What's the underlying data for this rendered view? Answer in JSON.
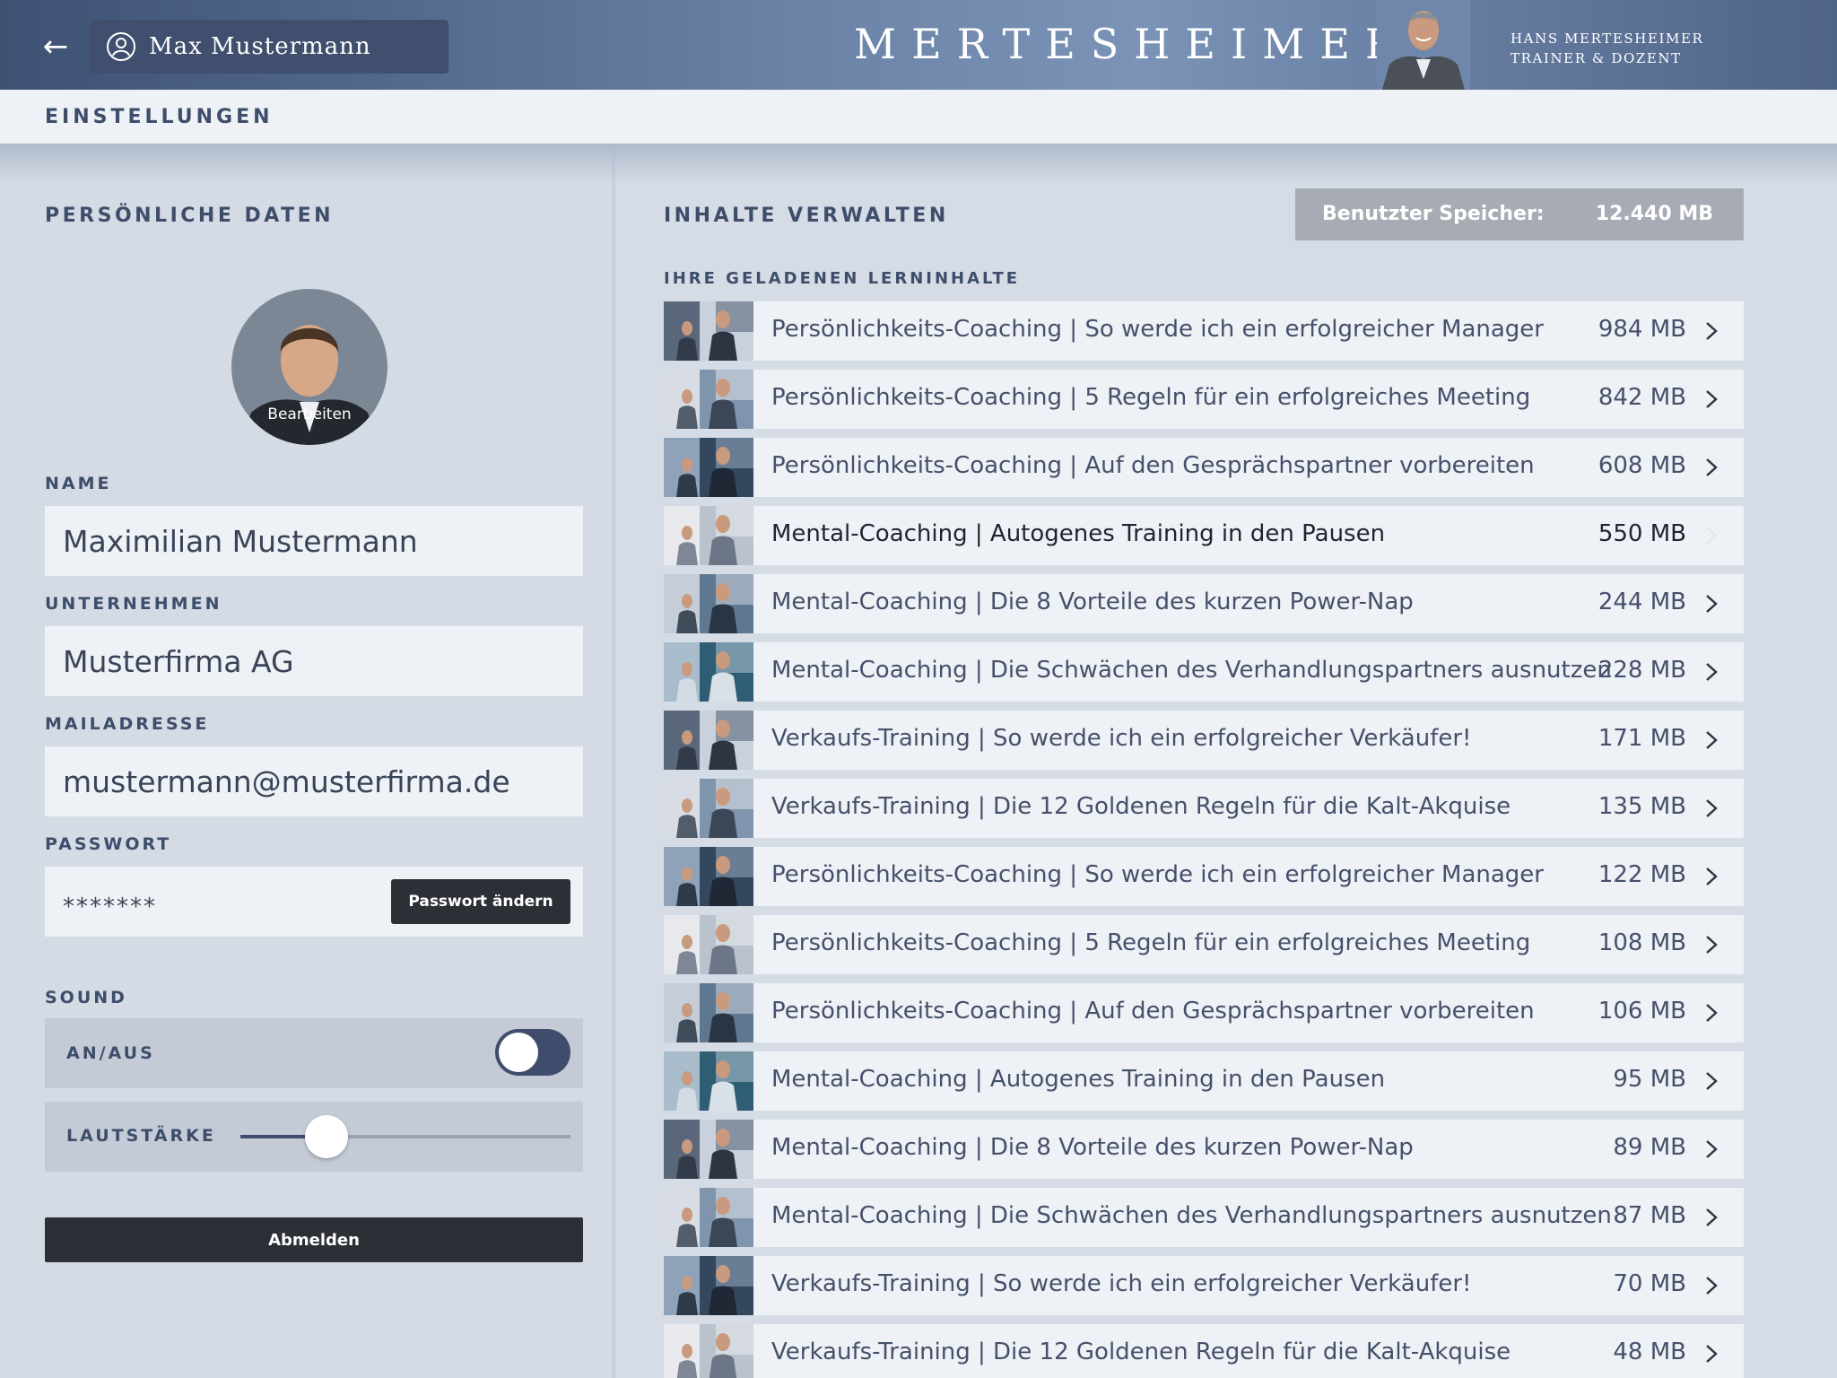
{
  "header": {
    "user_name": "Max Mustermann",
    "brand": "MERTESHEIMER",
    "trainer_name": "HANS MERTESHEIMER",
    "trainer_role": "TRAINER & DOZENT"
  },
  "page_title": "EINSTELLUNGEN",
  "personal": {
    "section_title": "PERSÖNLICHE DATEN",
    "avatar_edit_label": "Bearbeiten",
    "name_label": "NAME",
    "name_value": "Maximilian Mustermann",
    "company_label": "UNTERNEHMEN",
    "company_value": "Musterfirma AG",
    "email_label": "MAILADRESSE",
    "email_value": "mustermann@musterfirma.de",
    "password_label": "PASSWORT",
    "password_mask": "*******",
    "change_password_label": "Passwort ändern"
  },
  "sound": {
    "section_title": "SOUND",
    "toggle_label": "AN/AUS",
    "toggle_on": false,
    "volume_label": "LAUTSTÄRKE",
    "volume_level": 0.26
  },
  "logout_label": "Abmelden",
  "content": {
    "section_title": "INHALTE VERWALTEN",
    "storage_label": "Benutzter Speicher:",
    "storage_value": "12.440 MB",
    "list_title": "IHRE GELADENEN LERNINHALTE",
    "items": [
      {
        "title": "Persönlichkeits-Coaching | So werde ich ein erfolgreicher Manager",
        "size": "984 MB"
      },
      {
        "title": "Persönlichkeits-Coaching | 5 Regeln für ein erfolgreiches Meeting",
        "size": "842 MB"
      },
      {
        "title": "Persönlichkeits-Coaching | Auf den Gesprächspartner vorbereiten",
        "size": "608 MB"
      },
      {
        "title": "Mental-Coaching | Autogenes Training in den Pausen",
        "size": "550 MB",
        "active": true
      },
      {
        "title": "Mental-Coaching | Die 8 Vorteile des kurzen Power-Nap",
        "size": "244 MB"
      },
      {
        "title": "Mental-Coaching | Die Schwächen des Verhandlungspartners ausnutzen",
        "size": "228 MB"
      },
      {
        "title": "Verkaufs-Training | So werde ich ein erfolgreicher Verkäufer!",
        "size": "171 MB"
      },
      {
        "title": "Verkaufs-Training | Die 12 Goldenen Regeln für die Kalt-Akquise",
        "size": "135 MB"
      },
      {
        "title": "Persönlichkeits-Coaching | So werde ich ein erfolgreicher Manager",
        "size": "122 MB"
      },
      {
        "title": "Persönlichkeits-Coaching | 5 Regeln für ein erfolgreiches Meeting",
        "size": "108 MB"
      },
      {
        "title": "Persönlichkeits-Coaching | Auf den Gesprächspartner vorbereiten",
        "size": "106 MB"
      },
      {
        "title": "Mental-Coaching | Autogenes Training in den Pausen",
        "size": "95 MB"
      },
      {
        "title": "Mental-Coaching | Die 8 Vorteile des kurzen Power-Nap",
        "size": "89 MB"
      },
      {
        "title": "Mental-Coaching | Die Schwächen des Verhandlungspartners ausnutzen",
        "size": "87 MB"
      },
      {
        "title": "Verkaufs-Training | So werde ich ein erfolgreicher Verkäufer!",
        "size": "70 MB"
      },
      {
        "title": "Verkaufs-Training | Die 12 Goldenen Regeln für die Kalt-Akquise",
        "size": "48 MB"
      }
    ]
  },
  "colors": {
    "header_dark": "#3d5173",
    "accent_dark": "#3f4c6b",
    "button_dark": "#2c2f36",
    "panel_bg": "#d5dbe5",
    "field_bg": "#eef1f5"
  }
}
